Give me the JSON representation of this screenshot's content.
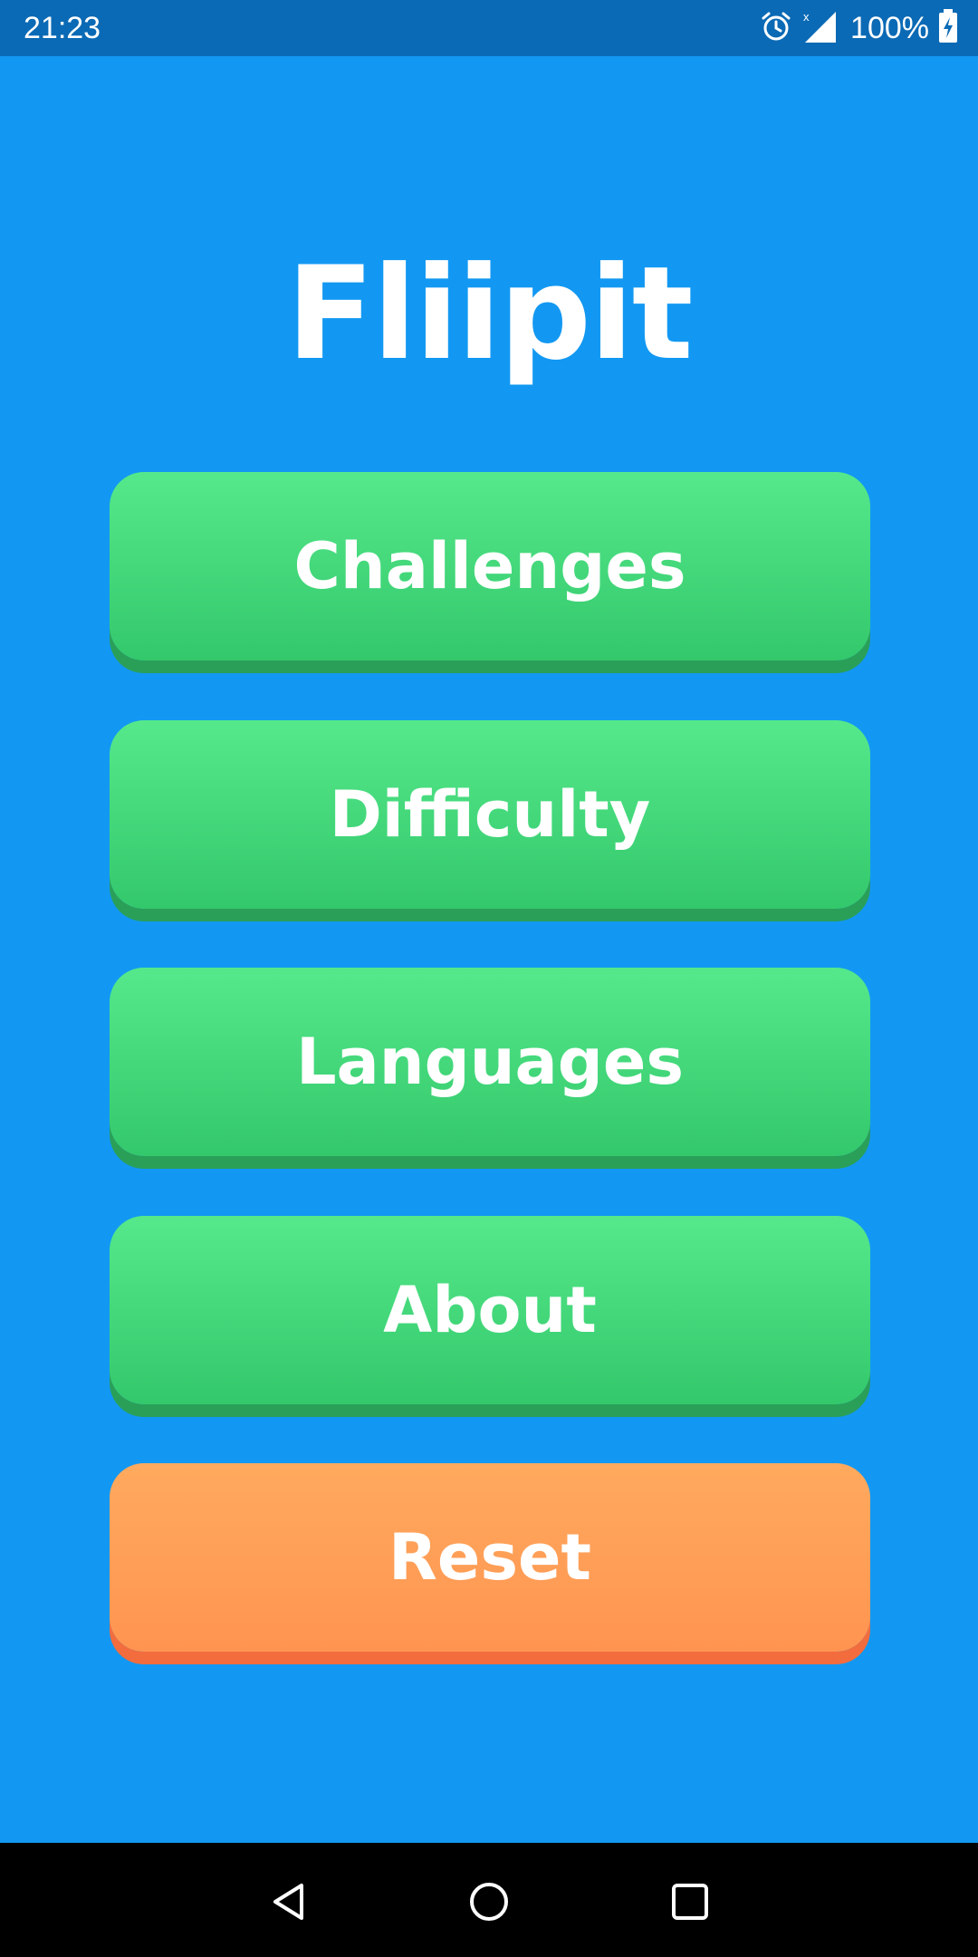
{
  "status_bar": {
    "time": "21:23",
    "battery": "100%",
    "icons": [
      "alarm-icon",
      "signal-icon",
      "battery-charging-icon"
    ]
  },
  "app": {
    "title": "Fliipit"
  },
  "menu": {
    "challenges": "Challenges",
    "difficulty": "Difficulty",
    "languages": "Languages",
    "about": "About",
    "reset": "Reset"
  },
  "colors": {
    "background": "#1298F2",
    "status_bar": "#0B6AB5",
    "button_green": "#45D97B",
    "button_orange": "#FFA057",
    "text": "#FFFFFF"
  },
  "nav_bar": {
    "icons": [
      "back-icon",
      "home-icon",
      "recents-icon"
    ]
  }
}
